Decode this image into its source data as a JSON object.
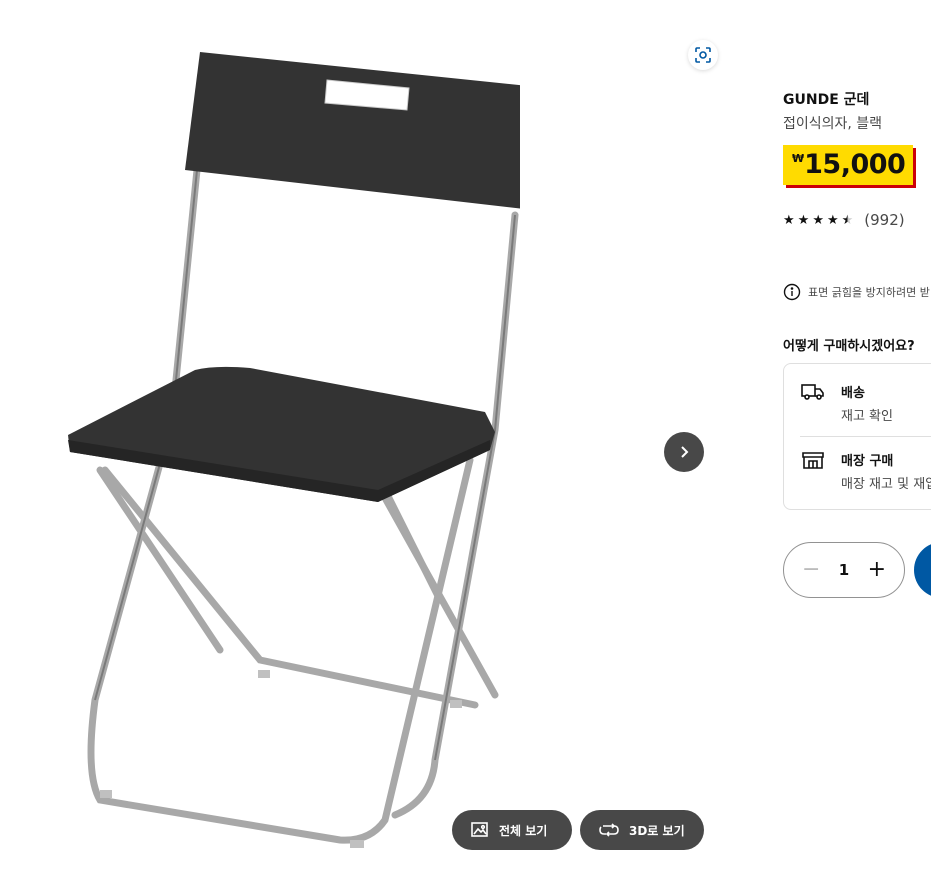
{
  "product": {
    "name": "GUNDE 군데",
    "description": "접이식의자, 블랙",
    "price_currency": "₩",
    "price": "15,000",
    "rating_value": 4.5,
    "rating_count": "(992)"
  },
  "gallery": {
    "image_icon": "folding-chair-image",
    "full_view_label": "전체 보기",
    "view_3d_label": "3D로 보기"
  },
  "notice": {
    "text": "표면 긁힘을 방지하려면 받"
  },
  "purchase": {
    "title": "어떻게 구매하시겠어요?",
    "delivery_title": "배송",
    "delivery_sub": "재고 확인",
    "store_title": "매장 구매",
    "store_sub": "매장 재고 및 재입"
  },
  "quantity": {
    "value": "1",
    "minus": "−",
    "plus": "+"
  },
  "colors": {
    "price_bg": "#ffdb00",
    "price_shadow": "#cc0008",
    "button_dark": "#484848",
    "primary_blue": "#0058a3"
  }
}
